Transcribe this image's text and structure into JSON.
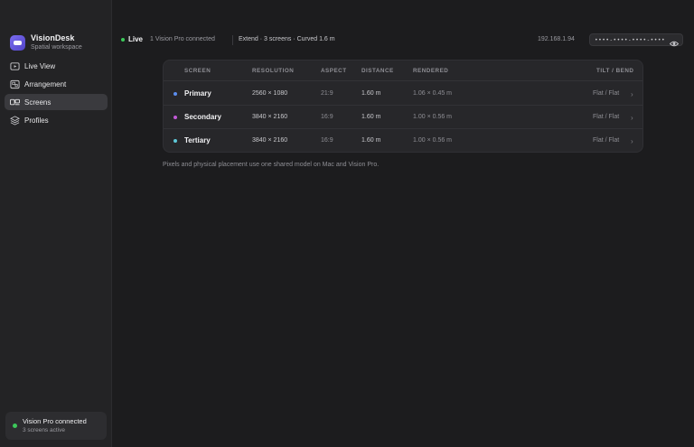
{
  "brand": {
    "name": "VisionDesk",
    "subtitle": "Spatial workspace"
  },
  "sidebar": {
    "items": [
      {
        "label": "Live View",
        "icon": "live-view-icon",
        "active": false
      },
      {
        "label": "Arrangement",
        "icon": "arrangement-icon",
        "active": false
      },
      {
        "label": "Screens",
        "icon": "screens-icon",
        "active": true
      },
      {
        "label": "Profiles",
        "icon": "profiles-icon",
        "active": false
      }
    ],
    "status": {
      "title": "Vision Pro connected",
      "subtitle": "3 screens active",
      "color": "#3cc85a"
    }
  },
  "topbar": {
    "live_label": "Live",
    "connection": "1 Vision Pro connected",
    "mode": "Extend · 3 screens · Curved 1.6 m",
    "ip": "192.168.1.94",
    "passcode": "••••-••••-••••-••••"
  },
  "table": {
    "headers": {
      "screen": "SCREEN",
      "resolution": "RESOLUTION",
      "aspect": "ASPECT",
      "distance": "DISTANCE",
      "rendered": "RENDERED",
      "tilt": "TILT / BEND"
    },
    "rows": [
      {
        "name": "Primary",
        "color": "#5b8def",
        "resolution": "2560 × 1080",
        "aspect": "21:9",
        "distance": "1.60 m",
        "rendered": "1.06 × 0.45 m",
        "tilt": "Flat / Flat"
      },
      {
        "name": "Secondary",
        "color": "#c25ad8",
        "resolution": "3840 × 2160",
        "aspect": "16:9",
        "distance": "1.60 m",
        "rendered": "1.00 × 0.56 m",
        "tilt": "Flat / Flat"
      },
      {
        "name": "Tertiary",
        "color": "#5ec8d8",
        "resolution": "3840 × 2160",
        "aspect": "16:9",
        "distance": "1.60 m",
        "rendered": "1.00 × 0.56 m",
        "tilt": "Flat / Flat"
      }
    ]
  },
  "footnote": "Pixels and physical placement use one shared model on Mac and Vision Pro."
}
